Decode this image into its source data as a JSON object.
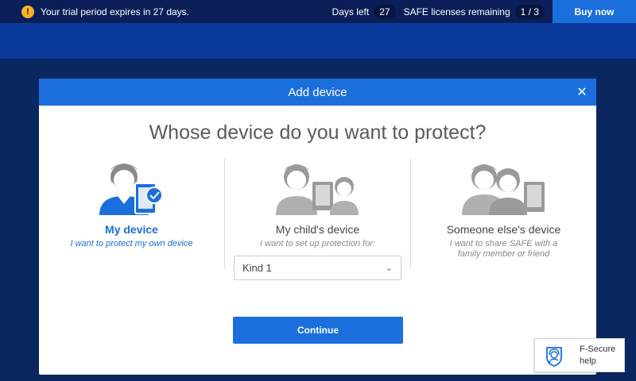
{
  "trial_bar": {
    "message": "Your trial period expires in 27 days.",
    "days_left_label": "Days left",
    "days_left_value": "27",
    "licenses_label": "SAFE licenses remaining",
    "licenses_value": "1 / 3",
    "buy_label": "Buy now",
    "warning_icon": "!"
  },
  "modal": {
    "title": "Add device",
    "question": "Whose device do you want to protect?",
    "options": [
      {
        "title": "My device",
        "subtitle": "I want to protect my own device",
        "selected": true
      },
      {
        "title": "My child's device",
        "subtitle": "I want to set up protection for:",
        "selected": false,
        "select_value": "Kind 1"
      },
      {
        "title": "Someone else's device",
        "subtitle": "I want to share SAFE with a family member or friend",
        "selected": false
      }
    ],
    "continue_label": "Continue"
  },
  "help": {
    "line1": "F-Secure",
    "line2": "help"
  },
  "colors": {
    "accent": "#1a6fdc",
    "warning": "#f5b324",
    "topbar": "#0a1f57"
  }
}
